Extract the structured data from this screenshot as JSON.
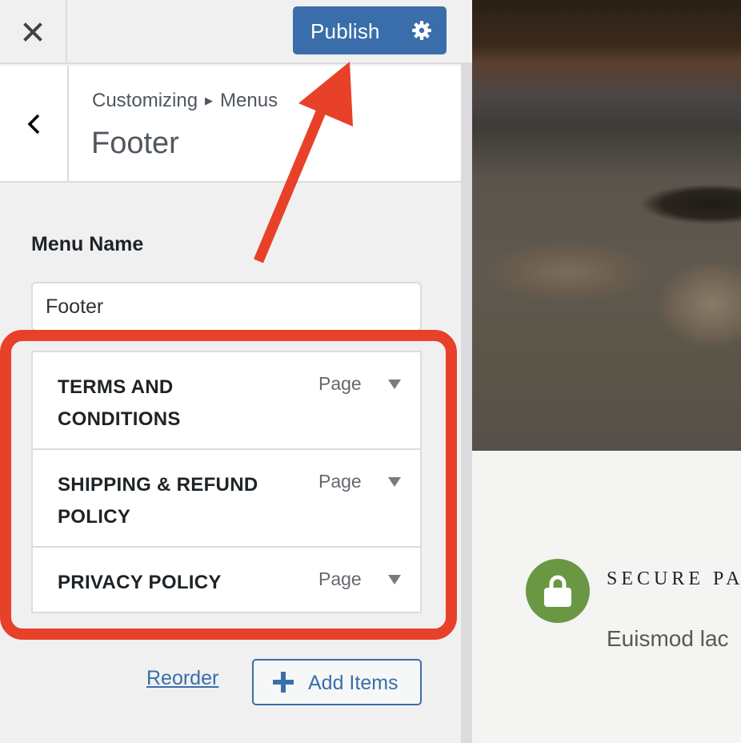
{
  "topbar": {
    "close_icon": "close-icon",
    "publish_label": "Publish",
    "publish_settings_icon": "gear-icon"
  },
  "section": {
    "back_icon": "chevron-left-icon",
    "breadcrumb": [
      "Customizing",
      "Menus"
    ],
    "breadcrumb_separator_icon": "triangle-right-icon",
    "title": "Footer"
  },
  "menu": {
    "name_label": "Menu Name",
    "name_value": "Footer",
    "items": [
      {
        "title": "TERMS AND CONDITIONS",
        "type": "Page"
      },
      {
        "title": "SHIPPING & REFUND POLICY",
        "type": "Page"
      },
      {
        "title": "PRIVACY POLICY",
        "type": "Page"
      }
    ],
    "reorder_label": "Reorder",
    "add_items_label": "Add Items"
  },
  "annotation": {
    "color": "#e8412a"
  },
  "preview": {
    "feature_icon": "lock-icon",
    "feature_title": "SECURE PA",
    "feature_text": "Euismod lac",
    "accent_color": "#6a9744"
  },
  "colors": {
    "primary": "#3a6eaa",
    "sidebar_bg": "#f0f0f1"
  }
}
